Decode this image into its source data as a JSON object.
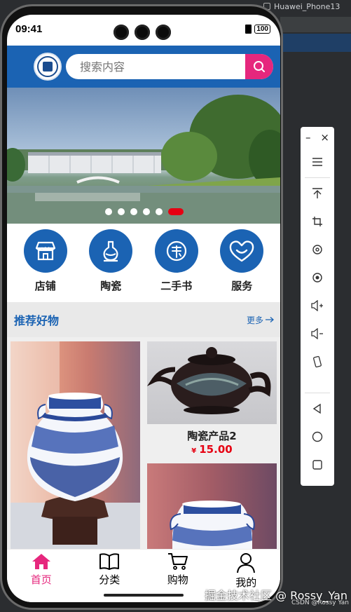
{
  "emulator": {
    "title": "Huawei_Phone13"
  },
  "status_bar": {
    "time": "09:41",
    "battery": "100"
  },
  "header": {
    "search_placeholder": "搜索内容"
  },
  "banner": {
    "slide_count": 6,
    "active_index": 5
  },
  "categories": [
    {
      "label": "店铺",
      "icon": "storefront-icon"
    },
    {
      "label": "陶瓷",
      "icon": "vase-icon"
    },
    {
      "label": "二手书",
      "icon": "book-icon"
    },
    {
      "label": "服务",
      "icon": "heart-smile-icon"
    }
  ],
  "recommend": {
    "title": "推荐好物",
    "more": "更多"
  },
  "products": [
    {
      "name": "陶瓷产品2",
      "price": "15.00",
      "currency": "¥"
    }
  ],
  "tabbar": [
    {
      "label": "首页",
      "icon": "home-icon",
      "active": true
    },
    {
      "label": "分类",
      "icon": "book-open-icon",
      "active": false
    },
    {
      "label": "购物",
      "icon": "cart-icon",
      "active": false
    },
    {
      "label": "我的",
      "icon": "user-icon",
      "active": false
    }
  ],
  "toolbar": {
    "minimize": "–",
    "close": "×"
  },
  "watermark": {
    "main": "掘金技术社区 @ Rossy_Yan",
    "small": "CSDN @Rossy Yan"
  },
  "colors": {
    "brand_blue": "#1b63b3",
    "accent_pink": "#e6277d",
    "price_red": "#e60012"
  }
}
